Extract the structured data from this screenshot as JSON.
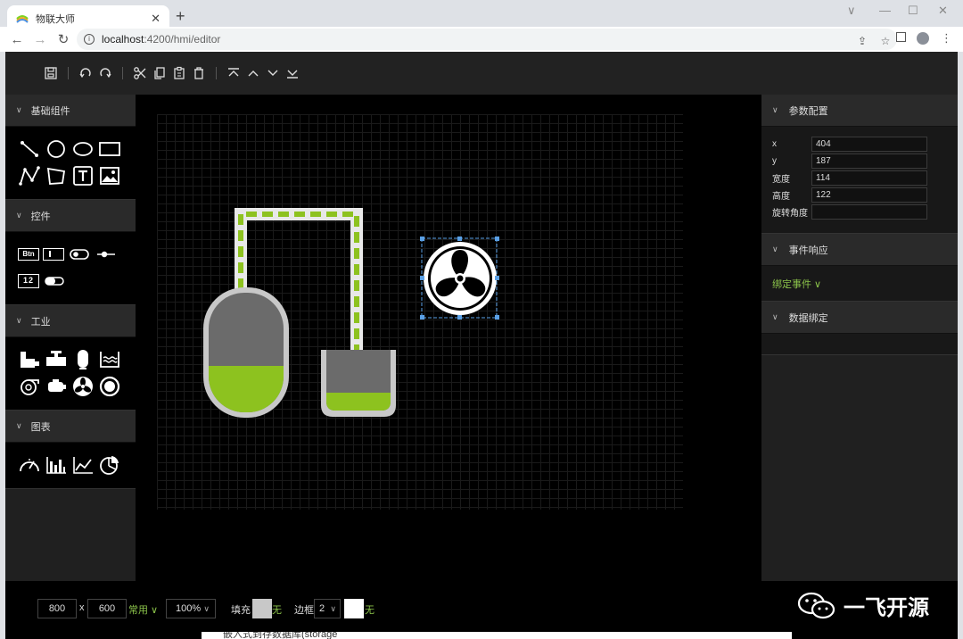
{
  "browser": {
    "tab_title": "物联大师",
    "url_host": "localhost",
    "url_path": ":4200/hmi/editor"
  },
  "panels": {
    "left_sections": [
      "基础组件",
      "控件",
      "工业",
      "图表"
    ],
    "right_sections": {
      "params": "参数配置",
      "events": "事件响应",
      "data": "数据绑定"
    }
  },
  "controls": {
    "btn_label": "Btn",
    "num_label": "12"
  },
  "properties": [
    {
      "label": "x",
      "value": "404"
    },
    {
      "label": "y",
      "value": "187"
    },
    {
      "label": "宽度",
      "value": "114"
    },
    {
      "label": "高度",
      "value": "122"
    },
    {
      "label": "旋转角度",
      "value": ""
    }
  ],
  "events": {
    "bind_label": "绑定事件 ∨"
  },
  "bottom": {
    "width": "800",
    "times": "x",
    "height": "600",
    "preset": "常用 ∨",
    "zoom": "100%",
    "fill_label": "填充",
    "fill_none": "无",
    "border_label": "边框",
    "border_width": "2",
    "border_none": "无"
  },
  "watermark": "一飞开源",
  "footer_text": "嵌入式到存数据库(storage",
  "colors": {
    "accent": "#8bc34a",
    "selection": "#5aa0e6",
    "tank_fill": "#8dc21f",
    "tank_body": "#6b6b6b",
    "tank_border": "#c8c8c8"
  }
}
